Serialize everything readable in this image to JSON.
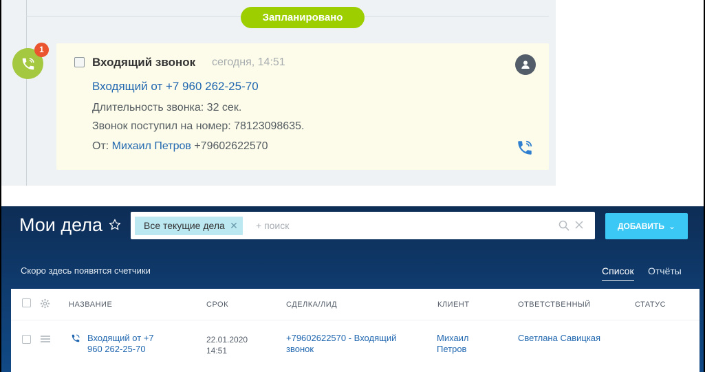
{
  "timeline": {
    "planned_label": "Запланировано",
    "badge_count": "1",
    "card": {
      "title": "Входящий звонок",
      "time": "сегодня, 14:51",
      "link": "Входящий от +7 960 262-25-70",
      "duration": "Длительность звонка: 32 сек.",
      "received_to": "Звонок поступил на номер: 78123098635.",
      "from_label": "От:",
      "from_name": "Михаил Петров",
      "from_phone": "+79602622570"
    }
  },
  "crm": {
    "page_title": "Мои дела",
    "filter_chip": "Все текущие дела",
    "search_placeholder": "+ поиск",
    "add_button": "ДОБАВИТЬ",
    "counters_text": "Скоро здесь появятся счетчики",
    "tabs": [
      {
        "label": "Список"
      },
      {
        "label": "Отчёты"
      }
    ],
    "columns": [
      "НАЗВАНИЕ",
      "СРОК",
      "СДЕЛКА/ЛИД",
      "КЛИЕНТ",
      "ОТВЕТСТВЕННЫЙ",
      "СТАТУС"
    ],
    "rows": [
      {
        "name_line1": "Входящий от +7",
        "name_line2": "960 262-25-70",
        "date_line1": "22.01.2020",
        "date_line2": "14:51",
        "deal_line1": "+79602622570 - Входящий",
        "deal_line2": "звонок",
        "client_line1": "Михаил",
        "client_line2": "Петров",
        "responsible": "Светлана Савицкая",
        "status": ""
      }
    ]
  },
  "colors": {
    "planned_green": "#9dcf00",
    "call_circle": "#a4c840",
    "badge_red": "#ea5530",
    "card_bg": "#fdfcea",
    "link_blue": "#2067b0",
    "add_button": "#3bc8f5",
    "header_dark": "#0f3a6c"
  },
  "icons": [
    "phone-icon",
    "user-icon",
    "star-icon",
    "search-icon",
    "close-icon",
    "chevron-down-icon",
    "gear-icon",
    "menu-icon"
  ]
}
